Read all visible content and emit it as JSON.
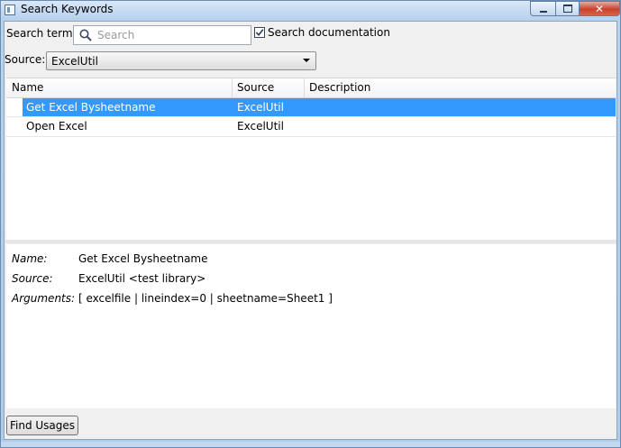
{
  "window": {
    "title": "Search Keywords",
    "close_glyph": "✕"
  },
  "search": {
    "term_label": "Search term:",
    "placeholder": "Search",
    "value": "",
    "doc_checkbox_label": "Search documentation",
    "doc_checked": true
  },
  "source": {
    "label": "Source:",
    "selected": "ExcelUtil"
  },
  "table": {
    "columns": [
      "Name",
      "Source",
      "Description"
    ],
    "rows": [
      {
        "name": "Get Excel Bysheetname",
        "source": "ExcelUtil",
        "description": "",
        "selected": true
      },
      {
        "name": "Open Excel",
        "source": "ExcelUtil",
        "description": "",
        "selected": false
      }
    ]
  },
  "details": {
    "name_label": "Name:",
    "name_value": "Get Excel Bysheetname",
    "source_label": "Source:",
    "source_value": "ExcelUtil <test library>",
    "args_label": "Arguments:",
    "args_value": "[ excelfile | lineindex=0 | sheetname=Sheet1 ]"
  },
  "footer": {
    "find_usages_label": "Find Usages"
  },
  "colors": {
    "selection": "#3399ff"
  }
}
